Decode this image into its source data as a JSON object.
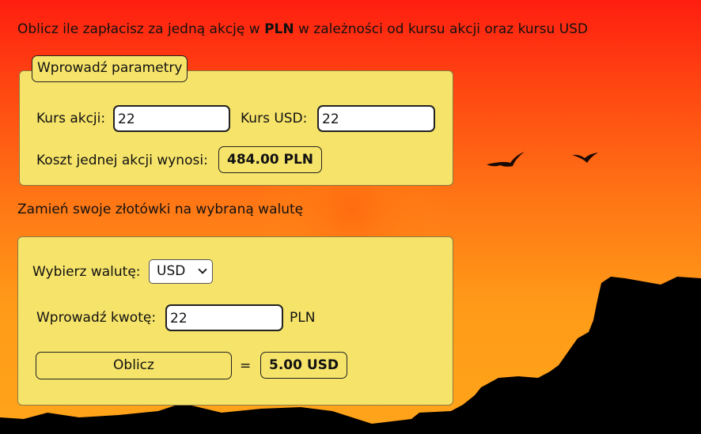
{
  "intro": {
    "prefix": "Oblicz ile zapłacisz za jedną akcję w ",
    "bold": "PLN",
    "suffix": " w zależności od kursu akcji oraz kursu USD"
  },
  "panel1": {
    "legend": "Wprowadź parametry",
    "stock_label": "Kurs akcji:",
    "stock_value": "22",
    "usd_label": "Kurs USD:",
    "usd_value": "22",
    "cost_label": "Koszt jednej akcji wynosi:",
    "cost_result": "484.00 PLN"
  },
  "subtitle": "Zamień swoje złotówki na wybraną walutę",
  "panel2": {
    "currency_label": "Wybierz walutę:",
    "currency_selected": "USD",
    "amount_label": "Wprowadź kwotę:",
    "amount_value": "22",
    "amount_unit": "PLN",
    "button": "Oblicz",
    "equals": "=",
    "result": "5.00 USD"
  }
}
